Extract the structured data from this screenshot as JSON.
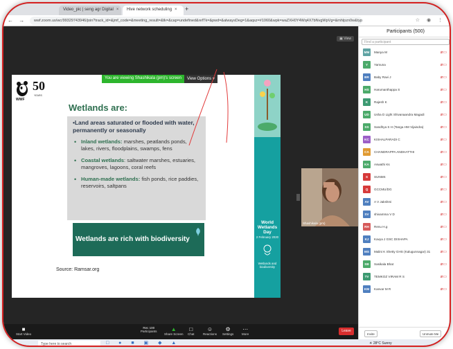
{
  "browser": {
    "tabs": [
      {
        "label": "Video_pic | seng agr Digital"
      },
      {
        "label": "Hive network scheduling"
      }
    ],
    "new_tab": "+",
    "nav": "← → ↻",
    "url": "wwf.zoom.us/wc/99329743946/join?track_id=&jmf_code=&meeting_result=&tk=&cap=undefined&refTk=&pwd=&alwaysDeg=1&aqsz=#1060&wpk=waZXH0Y4Wq4X7bNvgWpVg=&mhlpzn0w&type=ajk3c"
  },
  "banner": {
    "viewing": "You are viewing Shashikala (pm)'s screen",
    "view_options": "View Options ▾"
  },
  "meeting": {
    "view_button": "▣ View"
  },
  "slide": {
    "logo_text": "WWF",
    "fifty": "50",
    "fifty_sub": "YEARS",
    "title": "Wetlands are:",
    "intro": "•Land areas saturated or flooded with water, permanently or seasonally",
    "bullets": [
      {
        "head": "Inland wetlands:",
        "text": " marshes, peatlands ponds, lakes, rivers, floodplains, swamps, fens"
      },
      {
        "head": "Coastal wetlands",
        "text": ": saltwater marshes, estuaries, mangroves, lagoons, coral reefs"
      },
      {
        "head": "Human-made wetlands:",
        "text": " fish ponds, rice paddies, reservoirs, saltpans"
      }
    ],
    "biodiversity": "Wetlands are rich with biodiversity",
    "source": "Source: Ramsar.org",
    "right_title": "World Wetlands Day",
    "right_date": "2 February 2020",
    "right_sub": "Wetlands and biodiversity"
  },
  "video": {
    "name": "Shashikala (pm)"
  },
  "toolbar": {
    "items": [
      {
        "icon": "■",
        "label": "Start Video"
      },
      {
        "icon": "↑",
        "label": "Participants"
      },
      {
        "icon": "▲",
        "label": "Share Screen"
      },
      {
        "icon": "□",
        "label": "Chat"
      },
      {
        "icon": "☺",
        "label": "Reactions"
      },
      {
        "icon": "⚙",
        "label": "Settings"
      },
      {
        "icon": "⋯",
        "label": "More"
      }
    ],
    "participants_count": "Rec 100",
    "leave": "Leave"
  },
  "panel": {
    "title": "Participants (500)",
    "search_placeholder": "Find a participant",
    "participants": [
      {
        "initials": "MM",
        "name": "Manya M",
        "color": "#5fa3a3"
      },
      {
        "initials": "Y",
        "name": "Yamuna",
        "color": "#4caa6a"
      },
      {
        "initials": "BR",
        "name": "Baby Ravi J",
        "color": "#4f7fbf"
      },
      {
        "initials": "HS",
        "name": "Harumanthappa S",
        "color": "#4caa6a"
      },
      {
        "initials": "K",
        "name": "Rajesh K",
        "color": "#3d9a72"
      },
      {
        "initials": "UD",
        "name": "Usha D Light Shivanaandra Magadi",
        "color": "#4caa6a"
      },
      {
        "initials": "SS",
        "name": "Sandhya S H (Tanga HM Vijaindra)",
        "color": "#4caa6a"
      },
      {
        "initials": "KC",
        "name": "KISHALPARADI C",
        "color": "#9c5fc7"
      },
      {
        "initials": "CA",
        "name": "CHANDRAPPA ANDHATTHI",
        "color": "#e09a32"
      },
      {
        "initials": "KA",
        "name": "Aswathi Ks",
        "color": "#4caa6a"
      },
      {
        "initials": "S",
        "name": "SUNMS",
        "color": "#d63a3a"
      },
      {
        "initials": "Q",
        "name": "GCCMU/DG",
        "color": "#d63a3a"
      },
      {
        "initials": "AV",
        "name": "A V Jakshmi",
        "color": "#4f7fbf"
      },
      {
        "initials": "SV",
        "name": "shivamma V D",
        "color": "#4f7fbf"
      },
      {
        "initials": "RH",
        "name": "Renu H.g",
        "color": "#d65a5a"
      },
      {
        "initials": "KJ",
        "name": "Kavya J GSC DISHAPA",
        "color": "#4f7fbf"
      },
      {
        "initials": "MS",
        "name": "Malini K Shetty GHS (Kalugunnagar) 31",
        "color": "#4f7fbf"
      },
      {
        "initials": "SB",
        "name": "Sasikala Bhat",
        "color": "#4caa6a"
      },
      {
        "initials": "TV",
        "name": "TEMKOZ VIRAM R S",
        "color": "#3d9a72"
      },
      {
        "initials": "KM",
        "name": "Kanvar M R",
        "color": "#4f7fbf"
      }
    ],
    "invite": "Invite",
    "unmute": "Unmute Me"
  },
  "taskbar": {
    "search": "Type here to search",
    "icons": "□ ● ■ ▣ ◆ ▲",
    "weather": "☀ 28°C Sunny"
  },
  "colors": {
    "leave_red": "#d82e2e",
    "share_green": "#2db52d",
    "slide_title_green": "#2e6f4f",
    "frame_red": "#d61f1f"
  }
}
